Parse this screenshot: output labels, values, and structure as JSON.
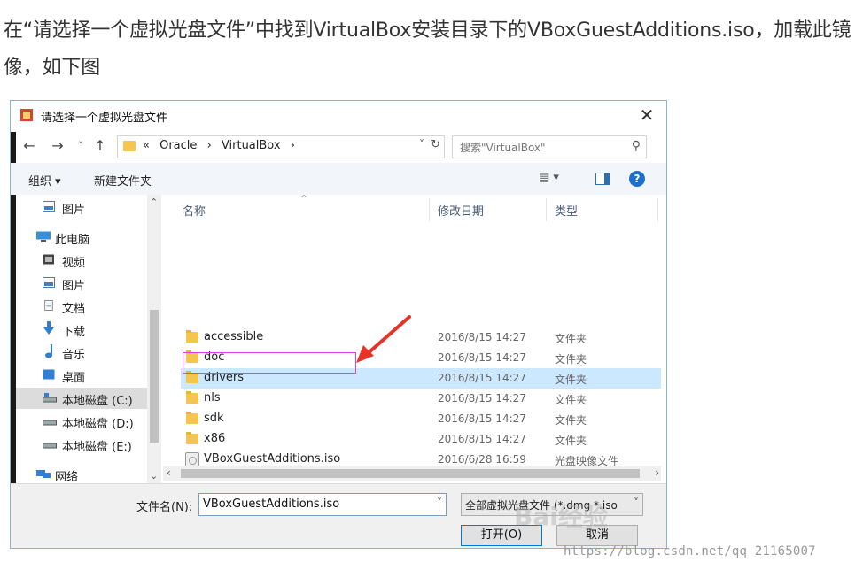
{
  "article": {
    "text": "在“请选择一个虚拟光盘文件”中找到VirtualBox安装目录下的VBoxGuestAdditions.iso，加载此镜像，如下图"
  },
  "dialog": {
    "title": "请选择一个虚拟光盘文件",
    "close": "✕",
    "nav": {
      "back": "←",
      "forward": "→",
      "recent": "˅",
      "up": "↑"
    },
    "address": {
      "prefix": "«",
      "crumbs": [
        "Oracle",
        "›",
        "VirtualBox",
        "›"
      ],
      "dropdown": "˅",
      "refresh": "↻"
    },
    "search": {
      "placeholder": "搜索\"VirtualBox\"",
      "icon": "⚲"
    },
    "toolbar": {
      "organize": "组织 ▾",
      "new_folder": "新建文件夹",
      "view": "▤ ▾",
      "help": "?"
    },
    "sidebar": {
      "items": [
        {
          "label": "图片",
          "icon": "pictures-icon"
        },
        {
          "label": "此电脑",
          "icon": "computer-icon"
        },
        {
          "label": "视频",
          "icon": "video-icon"
        },
        {
          "label": "图片",
          "icon": "pictures-icon"
        },
        {
          "label": "文档",
          "icon": "document-icon"
        },
        {
          "label": "下载",
          "icon": "download-icon"
        },
        {
          "label": "音乐",
          "icon": "music-icon"
        },
        {
          "label": "桌面",
          "icon": "desktop-icon"
        },
        {
          "label": "本地磁盘 (C:)",
          "icon": "drive-icon"
        },
        {
          "label": "本地磁盘 (D:)",
          "icon": "drive-icon"
        },
        {
          "label": "本地磁盘 (E:)",
          "icon": "drive-icon"
        },
        {
          "label": "网络",
          "icon": "network-icon"
        }
      ],
      "selected_index": 8
    },
    "columns": {
      "name": "名称",
      "date": "修改日期",
      "type": "类型"
    },
    "files": [
      {
        "name": "accessible",
        "date": "2016/8/15 14:27",
        "type": "文件夹",
        "kind": "folder"
      },
      {
        "name": "doc",
        "date": "2016/8/15 14:27",
        "type": "文件夹",
        "kind": "folder"
      },
      {
        "name": "drivers",
        "date": "2016/8/15 14:27",
        "type": "文件夹",
        "kind": "folder",
        "selected": true
      },
      {
        "name": "nls",
        "date": "2016/8/15 14:27",
        "type": "文件夹",
        "kind": "folder"
      },
      {
        "name": "sdk",
        "date": "2016/8/15 14:27",
        "type": "文件夹",
        "kind": "folder"
      },
      {
        "name": "x86",
        "date": "2016/8/15 14:27",
        "type": "文件夹",
        "kind": "folder"
      },
      {
        "name": "VBoxGuestAdditions.iso",
        "date": "2016/6/28 16:59",
        "type": "光盘映像文件",
        "kind": "disc-image"
      }
    ],
    "filename": {
      "label": "文件名(N):",
      "value": "VBoxGuestAdditions.iso"
    },
    "filter": {
      "value": "全部虚拟光盘文件 (*.dmg *.iso"
    },
    "buttons": {
      "open": "打开(O)",
      "cancel": "取消"
    }
  },
  "overlay": {
    "watermark": "Bai经验",
    "credit": "https://blog.csdn.net/qq_21165007"
  },
  "colors": {
    "selection": "#cce8ff",
    "highlight_box": "#e040e0",
    "arrow": "#e8332a",
    "folder": "#f4c64e"
  }
}
